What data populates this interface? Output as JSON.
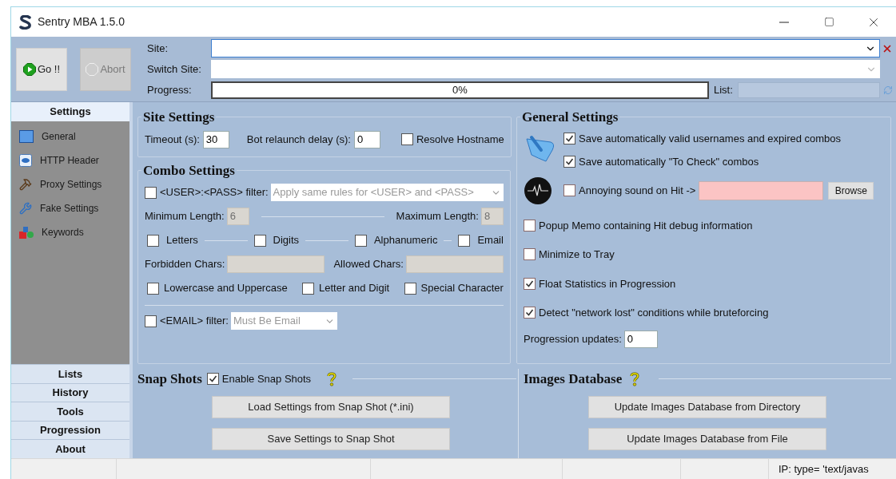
{
  "window": {
    "title": "Sentry MBA 1.5.0"
  },
  "toolbar": [
    {
      "label": "Go !!",
      "disabled": false
    },
    {
      "label": "Abort",
      "disabled": true
    }
  ],
  "site": {
    "label": "Site:"
  },
  "switch_site": {
    "label": "Switch Site:"
  },
  "progress": {
    "label": "Progress:",
    "text": "0%",
    "level": 0
  },
  "list": {
    "label": "List:"
  },
  "sidebar": {
    "header": {
      "label": "Settings",
      "selected": true
    },
    "items": [
      {
        "label": "General"
      },
      {
        "label": "HTTP Header"
      },
      {
        "label": "Proxy Settings"
      },
      {
        "label": "Fake Settings"
      },
      {
        "label": "Keywords"
      }
    ],
    "tabs": [
      {
        "label": "Lists",
        "selected": false
      },
      {
        "label": "History",
        "selected": false
      },
      {
        "label": "Tools",
        "selected": false
      },
      {
        "label": "Progression",
        "selected": false
      },
      {
        "label": "About",
        "selected": false
      }
    ]
  },
  "site_settings": {
    "title": "Site Settings",
    "timeout": {
      "label": "Timeout (s):",
      "value": "30"
    },
    "relaunch": {
      "label": "Bot relaunch delay (s):",
      "value": "0"
    },
    "resolve": {
      "label": "Resolve Hostname",
      "checked": false
    }
  },
  "combo_settings": {
    "title": "Combo Settings",
    "user_pass_filter": {
      "label": "<USER>:<PASS> filter:",
      "checked": false,
      "value": "Apply same rules for <USER> and <PASS>"
    },
    "min_length": {
      "label": "Minimum Length:",
      "value": "6"
    },
    "max_length": {
      "label": "Maximum Length:",
      "value": "8"
    },
    "char_types": [
      {
        "label": "Letters",
        "checked": false
      },
      {
        "label": "Digits",
        "checked": false
      },
      {
        "label": "Alphanumeric",
        "checked": false
      },
      {
        "label": "Email",
        "checked": false
      }
    ],
    "forbidden": {
      "label": "Forbidden Chars:"
    },
    "allowed": {
      "label": "Allowed Chars:"
    },
    "requirements": [
      {
        "label": "Lowercase and Uppercase",
        "checked": false
      },
      {
        "label": "Letter and Digit",
        "checked": false
      },
      {
        "label": "Special Character",
        "checked": false
      }
    ],
    "email_filter": {
      "label": "<EMAIL> filter:",
      "checked": false,
      "value": "Must Be Email"
    }
  },
  "general_settings": {
    "title": "General Settings",
    "save_options": [
      {
        "label": "Save automatically valid usernames and expired combos",
        "checked": true
      },
      {
        "label": "Save automatically \"To Check\" combos",
        "checked": true
      }
    ],
    "sound": {
      "label": "Annoying sound on Hit ->",
      "checked": false,
      "button": "Browse"
    },
    "options": [
      {
        "label": "Popup Memo containing Hit debug information",
        "checked": false
      },
      {
        "label": "Minimize to Tray",
        "checked": false
      },
      {
        "label": "Float Statistics in Progression",
        "checked": true
      },
      {
        "label": "Detect \"network lost\" conditions while bruteforcing",
        "checked": true
      }
    ],
    "progression_updates": {
      "label": "Progression updates:",
      "value": "0"
    }
  },
  "snap_shots": {
    "title": "Snap Shots",
    "enable": {
      "label": "Enable Snap Shots",
      "checked": true
    },
    "buttons": [
      "Load Settings from Snap Shot (*.ini)",
      "Save Settings to Snap Shot"
    ]
  },
  "images_database": {
    "title": "Images Database",
    "buttons": [
      "Update Images Database from Directory",
      "Update Images Database from File"
    ]
  },
  "status_bar": {
    "text": "IP: type= 'text/javas"
  }
}
